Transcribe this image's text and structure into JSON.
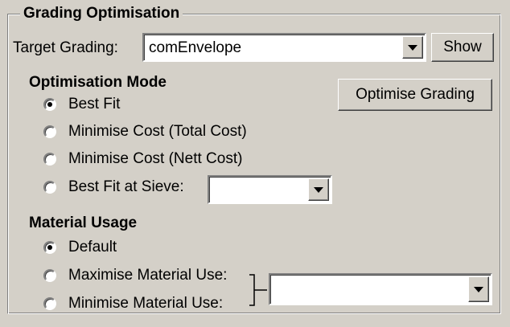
{
  "group": {
    "title": "Grading Optimisation"
  },
  "target": {
    "label": "Target Grading:",
    "value": "comEnvelope",
    "show_label": "Show"
  },
  "optimisation_mode": {
    "heading": "Optimisation Mode",
    "options": [
      {
        "label": "Best Fit",
        "selected": true
      },
      {
        "label": "Minimise Cost (Total Cost)",
        "selected": false
      },
      {
        "label": "Minimise Cost (Nett Cost)",
        "selected": false
      },
      {
        "label": "Best Fit at Sieve:",
        "selected": false
      }
    ],
    "sieve_value": "",
    "optimise_label": "Optimise Grading"
  },
  "material_usage": {
    "heading": "Material Usage",
    "options": [
      {
        "label": "Default",
        "selected": true
      },
      {
        "label": "Maximise Material Use:",
        "selected": false
      },
      {
        "label": "Minimise Material Use:",
        "selected": false
      }
    ],
    "material_value": ""
  },
  "icons": {
    "dropdown": "chevron-down-icon",
    "radio": "radio-icon"
  },
  "colors": {
    "face": "#d4d0c8",
    "field": "#ffffff"
  }
}
